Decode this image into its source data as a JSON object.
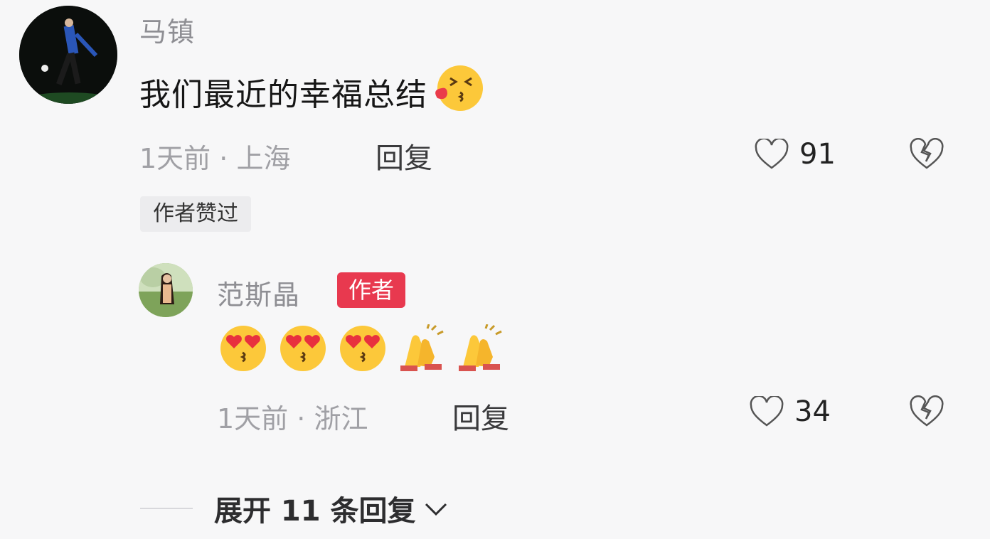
{
  "comments": [
    {
      "username": "马镇",
      "text": "我们最近的幸福总结",
      "emoji": "kiss-blow-icon",
      "time": "1天前",
      "separator": "·",
      "location": "上海",
      "reply_label": "回复",
      "like_count": "91",
      "author_liked_label": "作者赞过"
    },
    {
      "username": "范斯晶",
      "author_badge": "作者",
      "emojis": [
        "heart-eyes-kiss-icon",
        "heart-eyes-kiss-icon",
        "heart-eyes-kiss-icon",
        "clapping-hands-icon",
        "clapping-hands-icon"
      ],
      "time": "1天前",
      "separator": "·",
      "location": "浙江",
      "reply_label": "回复",
      "like_count": "34"
    }
  ],
  "expand_replies_label": "展开 11 条回复",
  "colors": {
    "background": "#f7f7f8",
    "author_badge_bg": "#e8394f",
    "muted_text": "#a0a0a5"
  }
}
